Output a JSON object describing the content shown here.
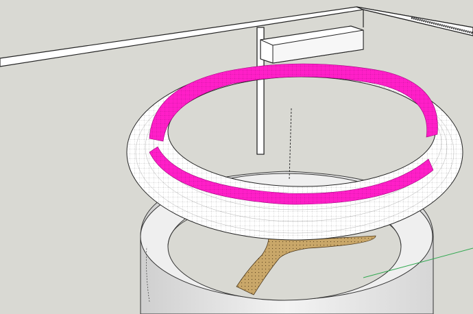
{
  "app": {
    "view": "3d-model-viewport"
  },
  "scene": {
    "background_color": "#d9d9d3",
    "objects": [
      {
        "name": "rail-frame",
        "color": "#ffffff"
      },
      {
        "name": "wall-shelf-box",
        "color": "#ffffff"
      },
      {
        "name": "torus-ring-mesh",
        "color": "#ffffff"
      },
      {
        "name": "selected-faces-band",
        "color": "#ff22cc"
      },
      {
        "name": "cylindrical-base-ring",
        "color": "#e6e6e6"
      },
      {
        "name": "twisted-wood-stand",
        "color": "#c8a66a"
      },
      {
        "name": "vertical-guide-line",
        "color": "#333333"
      },
      {
        "name": "green-axis-line",
        "color": "#2fa84f"
      }
    ]
  }
}
